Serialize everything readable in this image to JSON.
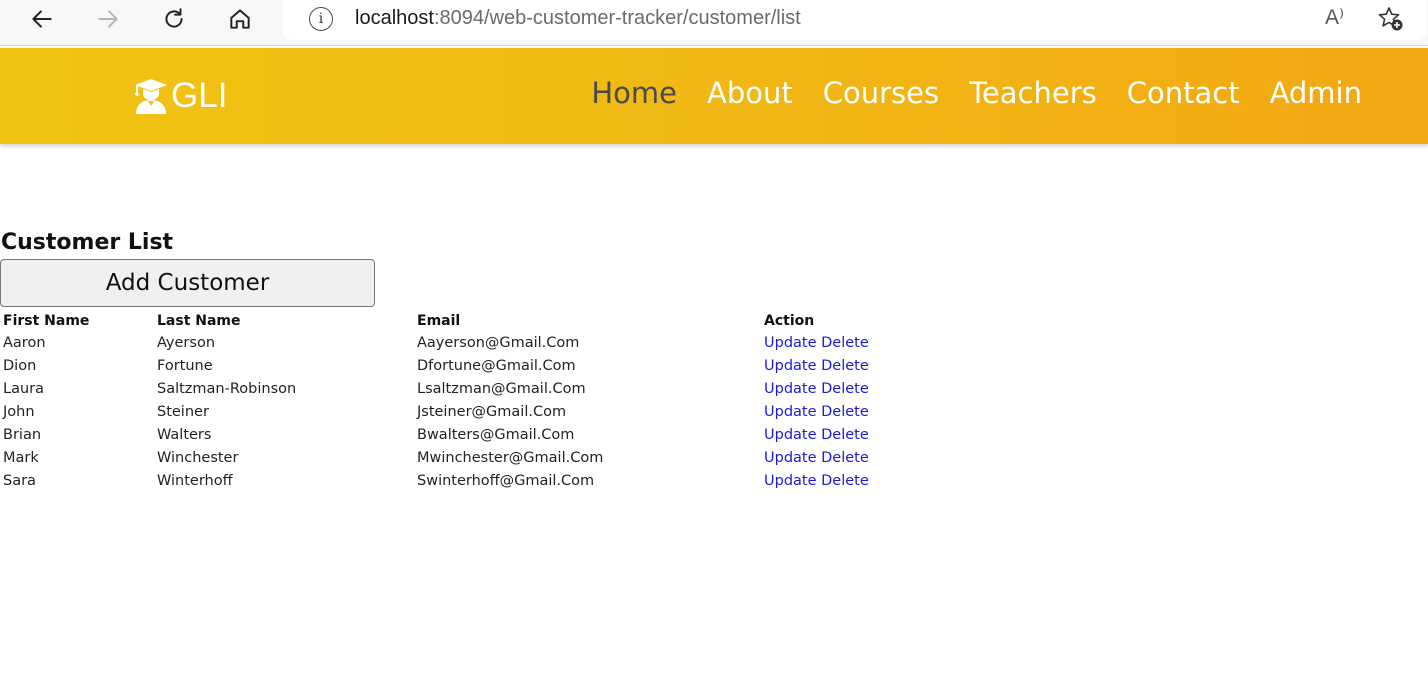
{
  "browser": {
    "url_host": "localhost",
    "url_path": ":8094/web-customer-tracker/customer/list",
    "read_aloud_glyph": "A⁾",
    "icons": [
      "back-arrow-icon",
      "forward-arrow-icon",
      "refresh-icon",
      "home-icon",
      "info-icon",
      "read-aloud-icon",
      "add-favorite-icon"
    ]
  },
  "header": {
    "logo_text": "GLI",
    "logo_icon": "graduate-icon",
    "nav": [
      {
        "label": "Home",
        "active": true
      },
      {
        "label": "About",
        "active": false
      },
      {
        "label": "Courses",
        "active": false
      },
      {
        "label": "Teachers",
        "active": false
      },
      {
        "label": "Contact",
        "active": false
      },
      {
        "label": "Admin",
        "active": false
      }
    ],
    "colors": {
      "gradient_start": "#f1c413",
      "gradient_end": "#f2a812",
      "active_nav": "#4a4a4a"
    }
  },
  "main": {
    "title": "Customer List",
    "add_button": "Add Customer",
    "columns": [
      "First Name",
      "Last Name",
      "Email",
      "Action"
    ],
    "rows": [
      {
        "first": "Aaron",
        "last": "Ayerson",
        "email": "Aayerson@Gmail.Com"
      },
      {
        "first": "Dion",
        "last": "Fortune",
        "email": "Dfortune@Gmail.Com"
      },
      {
        "first": "Laura",
        "last": "Saltzman-Robinson",
        "email": "Lsaltzman@Gmail.Com"
      },
      {
        "first": "John",
        "last": "Steiner",
        "email": "Jsteiner@Gmail.Com"
      },
      {
        "first": "Brian",
        "last": "Walters",
        "email": "Bwalters@Gmail.Com"
      },
      {
        "first": "Mark",
        "last": "Winchester",
        "email": "Mwinchester@Gmail.Com"
      },
      {
        "first": "Sara",
        "last": "Winterhoff",
        "email": "Swinterhoff@Gmail.Com"
      }
    ],
    "actions": {
      "update": "Update",
      "delete": "Delete"
    },
    "link_color": "#1a1adb"
  }
}
